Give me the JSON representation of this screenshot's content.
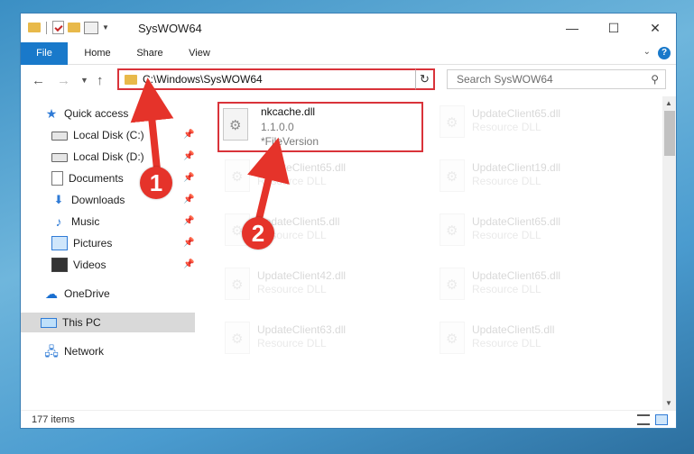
{
  "window": {
    "title": "SysWOW64",
    "controls": {
      "minimize": "—",
      "maximize": "☐",
      "close": "✕"
    }
  },
  "ribbon": {
    "tabs": [
      "File",
      "Home",
      "Share",
      "View"
    ],
    "help": "?"
  },
  "navigation": {
    "address_path": "C:\\Windows\\SysWOW64",
    "search_placeholder": "Search SysWOW64"
  },
  "sidebar": {
    "items": [
      {
        "label": "Quick access",
        "icon": "star-icon"
      },
      {
        "label": "Local Disk (C:)",
        "icon": "disk-icon",
        "pinned": true
      },
      {
        "label": "Local Disk (D:)",
        "icon": "disk-icon",
        "pinned": true
      },
      {
        "label": "Documents",
        "icon": "documents-icon",
        "pinned": true
      },
      {
        "label": "Downloads",
        "icon": "downloads-icon",
        "pinned": true
      },
      {
        "label": "Music",
        "icon": "music-icon",
        "pinned": true
      },
      {
        "label": "Pictures",
        "icon": "pictures-icon",
        "pinned": true
      },
      {
        "label": "Videos",
        "icon": "videos-icon",
        "pinned": true
      },
      {
        "label": "OneDrive",
        "icon": "onedrive-icon"
      },
      {
        "label": "This PC",
        "icon": "this-pc-icon",
        "selected": true
      },
      {
        "label": "Network",
        "icon": "network-icon"
      }
    ]
  },
  "files": [
    {
      "name": "nkcache.dll",
      "line2": "1.1.0.0",
      "line3": "*FileVersion",
      "highlighted": true
    },
    {
      "name": "UpdateClient65.dll",
      "line2": "Resource DLL",
      "faded": true
    },
    {
      "name": "UpdateClient65.dll",
      "line2": "Resource DLL",
      "faded": true
    },
    {
      "name": "UpdateClient19.dll",
      "line2": "Resource DLL",
      "faded": true
    },
    {
      "name": "UpdateClient5.dll",
      "line2": "Resource DLL",
      "faded": true
    },
    {
      "name": "UpdateClient65.dll",
      "line2": "Resource DLL",
      "faded": true
    },
    {
      "name": "UpdateClient42.dll",
      "line2": "Resource DLL",
      "faded": true
    },
    {
      "name": "UpdateClient65.dll",
      "line2": "Resource DLL",
      "faded": true
    },
    {
      "name": "UpdateClient63.dll",
      "line2": "Resource DLL",
      "faded": true
    },
    {
      "name": "UpdateClient5.dll",
      "line2": "Resource DLL",
      "faded": true
    }
  ],
  "status": {
    "item_count": "177 items"
  },
  "annotations": {
    "callout_1": "1",
    "callout_2": "2"
  },
  "colors": {
    "accent": "#1979ca",
    "highlight_border": "#d9333a",
    "callout": "#e5332a"
  }
}
